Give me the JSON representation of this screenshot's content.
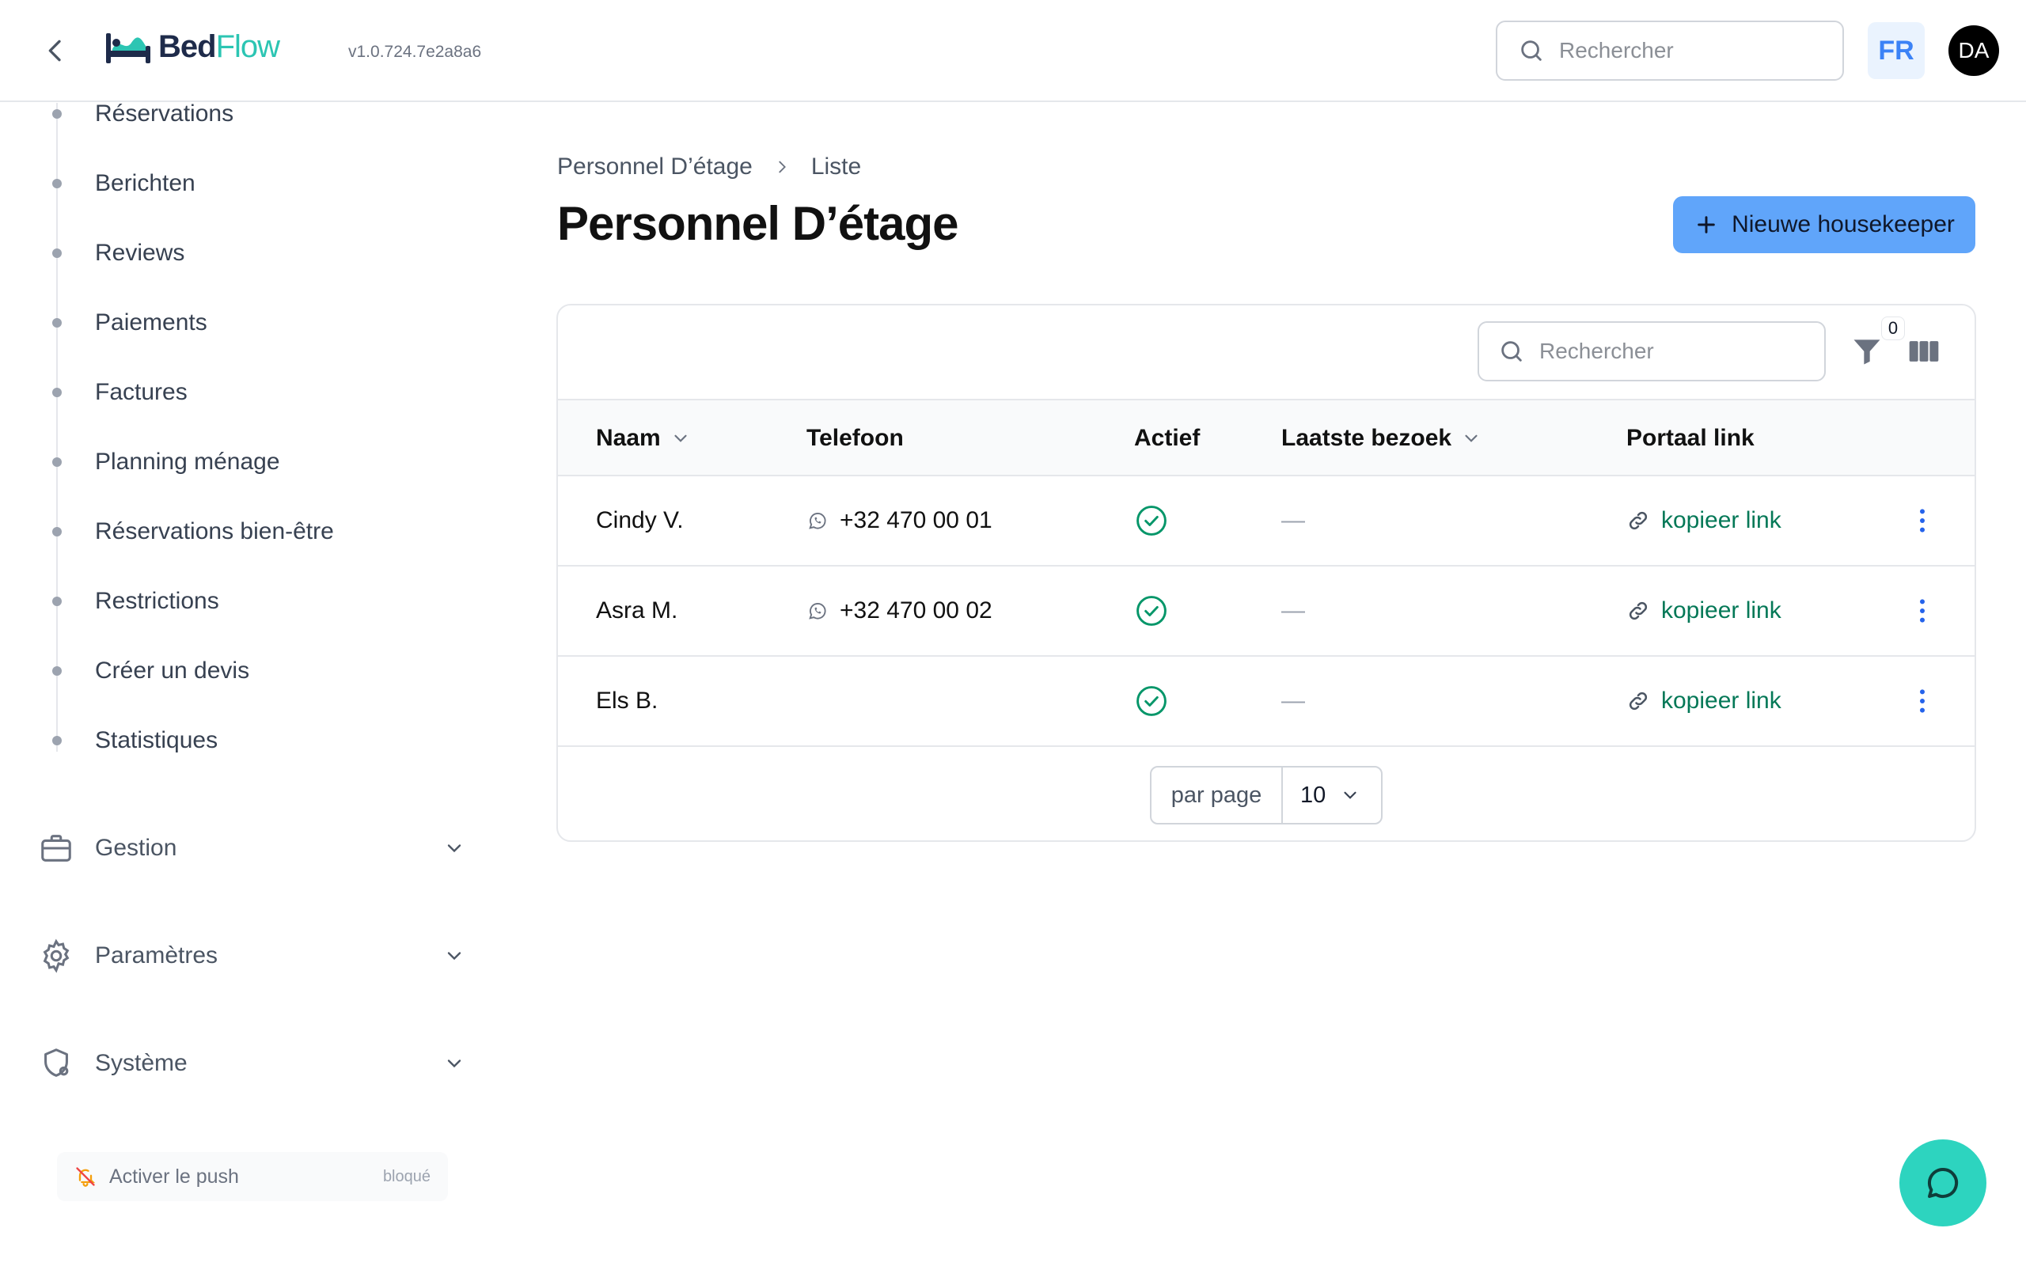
{
  "header": {
    "logo_bed": "Bed",
    "logo_flow": "Flow",
    "version": "v1.0.724.7e2a8a6",
    "search_placeholder": "Rechercher",
    "language": "FR",
    "avatar_initials": "DA"
  },
  "sidebar": {
    "items": [
      {
        "label": "Réservations"
      },
      {
        "label": "Berichten"
      },
      {
        "label": "Reviews"
      },
      {
        "label": "Paiements"
      },
      {
        "label": "Factures"
      },
      {
        "label": "Planning ménage"
      },
      {
        "label": "Réservations bien-être"
      },
      {
        "label": "Restrictions"
      },
      {
        "label": "Créer un devis"
      },
      {
        "label": "Statistiques"
      }
    ],
    "groups": [
      {
        "label": "Gestion",
        "icon": "briefcase-icon"
      },
      {
        "label": "Paramètres",
        "icon": "gear-icon"
      },
      {
        "label": "Système",
        "icon": "shield-gear-icon"
      }
    ],
    "push": {
      "label": "Activer le push",
      "state": "bloqué"
    }
  },
  "main": {
    "breadcrumb": [
      "Personnel D’étage",
      "Liste"
    ],
    "title": "Personnel D’étage",
    "new_button": "Nieuwe housekeeper",
    "table": {
      "search_placeholder": "Rechercher",
      "filter_count": "0",
      "columns": [
        "Naam",
        "Telefoon",
        "Actief",
        "Laatste bezoek",
        "Portaal link"
      ],
      "rows": [
        {
          "name": "Cindy V.",
          "phone": "+32 470 00 01",
          "active": true,
          "last_visit": "—",
          "link": "kopieer link"
        },
        {
          "name": "Asra M.",
          "phone": "+32 470 00 02",
          "active": true,
          "last_visit": "—",
          "link": "kopieer link"
        },
        {
          "name": "Els B.",
          "phone": "",
          "active": true,
          "last_visit": "—",
          "link": "kopieer link"
        }
      ],
      "per_page_label": "par page",
      "per_page_value": "10"
    }
  },
  "colors": {
    "accent": "#60a5fa",
    "brand_teal": "#2cc5b3",
    "success": "#059669",
    "link": "#047857"
  }
}
